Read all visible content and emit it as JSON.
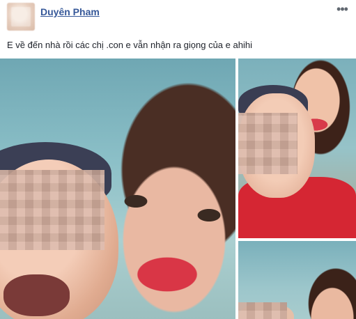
{
  "post": {
    "author": "Duyên Pham",
    "more_label": "•••",
    "text": "E về đến nhà rồi các chị .con e vẫn nhận ra giọng của e ahihi"
  }
}
